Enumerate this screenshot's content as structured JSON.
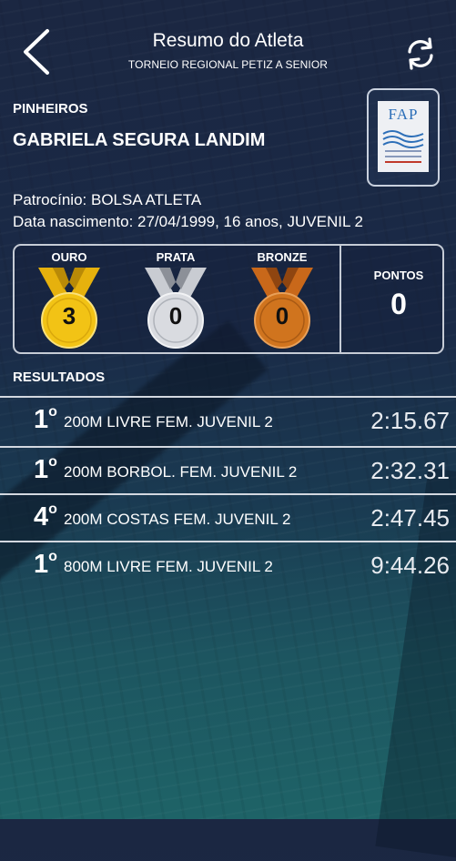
{
  "header": {
    "title": "Resumo do Atleta",
    "subtitle": "TORNEIO REGIONAL PETIZ A SENIOR"
  },
  "athlete": {
    "club": "PINHEIROS",
    "name": "GABRIELA SEGURA LANDIM",
    "sponsor": "Patrocínio: BOLSA ATLETA",
    "birth": "Data nascimento: 27/04/1999, 16 anos, JUVENIL 2",
    "logo_text": "FAP"
  },
  "medals": {
    "gold": {
      "label": "OURO",
      "count": "3",
      "color": "#f2c315"
    },
    "silver": {
      "label": "PRATA",
      "count": "0",
      "color": "#d9dbe0"
    },
    "bronze": {
      "label": "BRONZE",
      "count": "0",
      "color": "#d0741e"
    },
    "points_label": "PONTOS",
    "points_value": "0"
  },
  "results": {
    "heading": "RESULTADOS",
    "items": [
      {
        "place": "1",
        "suffix": "o",
        "event": "200M LIVRE FEM. JUVENIL 2",
        "time": "2:15.67"
      },
      {
        "place": "1",
        "suffix": "o",
        "event": "200M BORBOL. FEM. JUVENIL 2",
        "time": "2:32.31"
      },
      {
        "place": "4",
        "suffix": "o",
        "event": "200M COSTAS FEM. JUVENIL 2",
        "time": "2:47.45"
      },
      {
        "place": "1",
        "suffix": "o",
        "event": "800M LIVRE FEM. JUVENIL 2",
        "time": "9:44.26"
      }
    ]
  },
  "icons": {
    "back": "chevron-left-icon",
    "refresh": "refresh-icon"
  }
}
